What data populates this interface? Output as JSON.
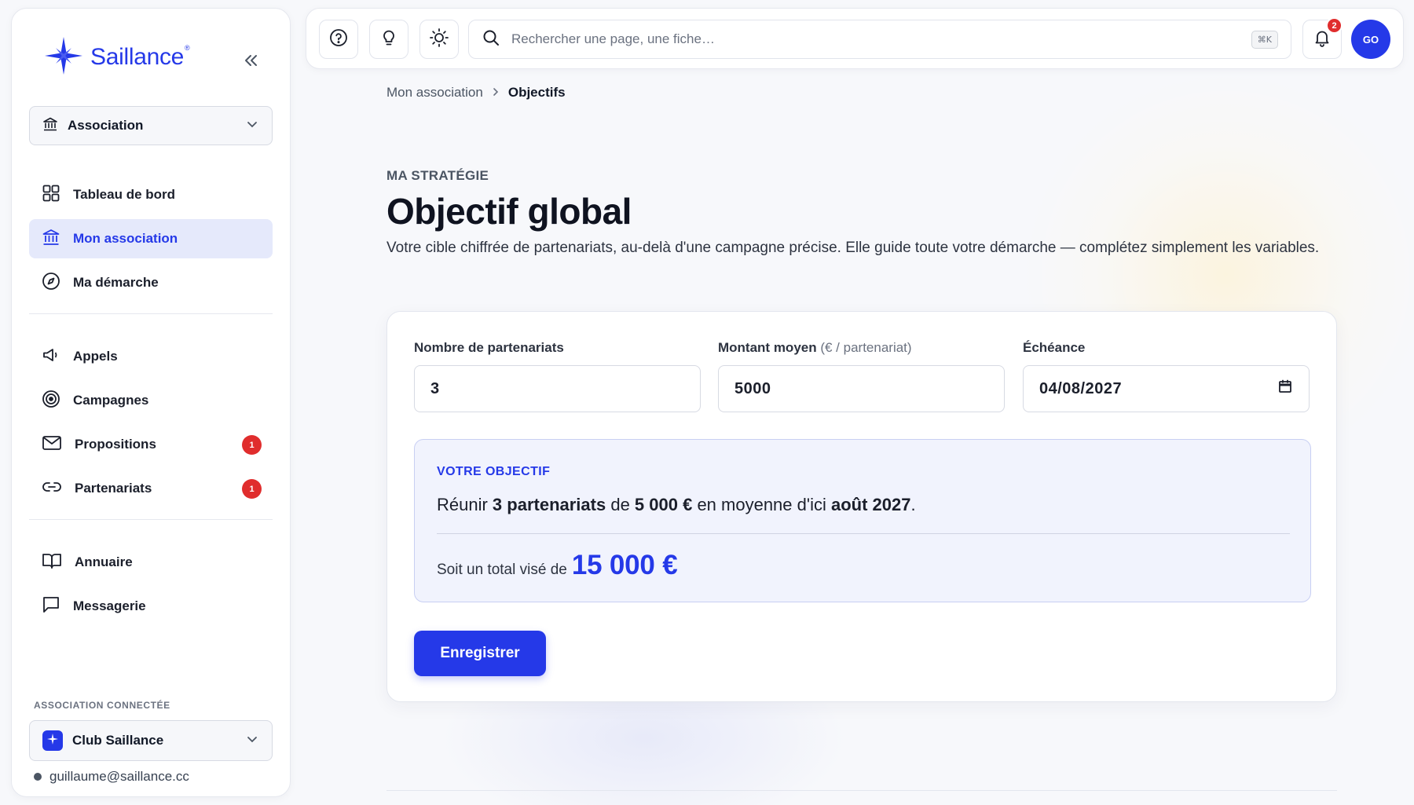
{
  "colors": {
    "accent": "#2539e8",
    "badge": "#e02d2d",
    "active_bg": "#e5e9fb"
  },
  "brand": {
    "name": "Saillance",
    "mark": "®",
    "logo_icon": "sparkle-star-icon"
  },
  "sidebar": {
    "association_select": {
      "label": "Association",
      "icon": "bank-icon"
    },
    "nav_main": [
      {
        "label": "Tableau de bord",
        "icon": "grid-icon"
      },
      {
        "label": "Mon association",
        "icon": "bank-icon",
        "active": true
      },
      {
        "label": "Ma démarche",
        "icon": "compass-icon"
      }
    ],
    "nav_ops": [
      {
        "label": "Appels",
        "icon": "megaphone-icon"
      },
      {
        "label": "Campagnes",
        "icon": "target-icon"
      },
      {
        "label": "Propositions",
        "icon": "mail-icon",
        "badge": "1"
      },
      {
        "label": "Partenariats",
        "icon": "link-icon",
        "badge": "1"
      }
    ],
    "nav_tools": [
      {
        "label": "Annuaire",
        "icon": "book-icon"
      },
      {
        "label": "Messagerie",
        "icon": "chat-icon"
      }
    ],
    "footer": {
      "label": "ASSOCIATION CONNECTÉE",
      "club_name": "Club Saillance",
      "user_email": "guillaume@saillance.cc"
    }
  },
  "topbar": {
    "help_icon": "help-circle-icon",
    "idea_icon": "lightbulb-icon",
    "theme_icon": "sun-icon",
    "search_placeholder": "Rechercher une page, une fiche…",
    "search_shortcut": "⌘K",
    "notifications_count": "2",
    "avatar_initials": "GO"
  },
  "breadcrumb": {
    "parent": "Mon association",
    "current": "Objectifs"
  },
  "page": {
    "eyebrow": "MA STRATÉGIE",
    "title": "Objectif global",
    "description": "Votre cible chiffrée de partenariats, au-delà d'une campagne précise. Elle guide toute votre démarche — complétez simplement les variables."
  },
  "form": {
    "partnerships": {
      "label": "Nombre de partenariats",
      "value": "3"
    },
    "average_amount": {
      "label": "Montant moyen",
      "label_suffix": "(€ / partenariat)",
      "value": "5000"
    },
    "deadline": {
      "label": "Échéance",
      "value": "04/08/2027"
    }
  },
  "goal": {
    "label": "VOTRE OBJECTIF",
    "sentence_prefix": "Réunir ",
    "count_text": "3 partenariats",
    "mid1": " de ",
    "amount_text": "5 000 €",
    "mid2": " en moyenne d'ici ",
    "date_text": "août 2027",
    "end": ".",
    "total_prefix": "Soit un total visé de",
    "total_amount": "15 000 €"
  },
  "actions": {
    "save_label": "Enregistrer"
  }
}
